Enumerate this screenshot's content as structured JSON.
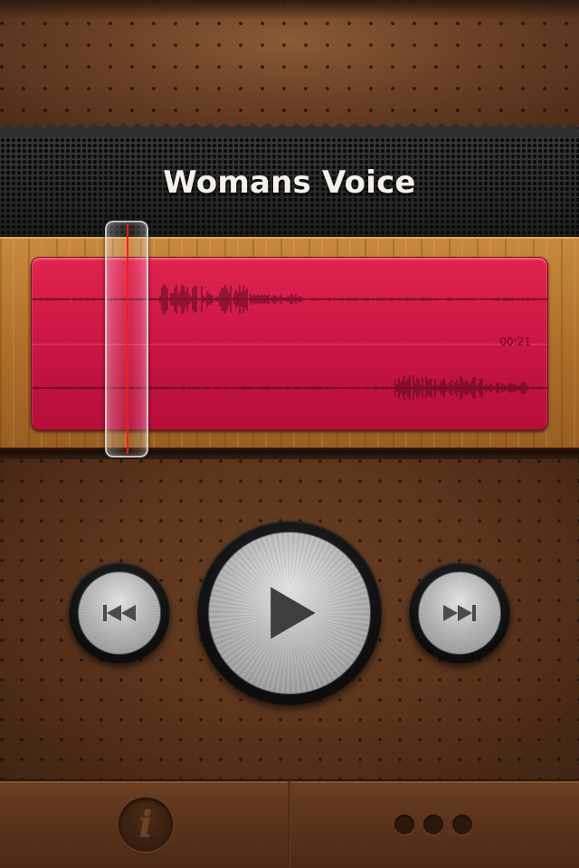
{
  "header": {
    "title": "Womans Voice"
  },
  "waveform": {
    "duration_label": "00:21",
    "playhead_fraction": 0.19
  },
  "controls": {
    "rewind": {
      "icon": "rewind-icon"
    },
    "play": {
      "icon": "play-icon"
    },
    "forward": {
      "icon": "fast-forward-icon"
    }
  },
  "toolbar": {
    "info": {
      "icon": "info-icon",
      "glyph": "i"
    },
    "more": {
      "icon": "more-dots-icon"
    }
  },
  "colors": {
    "waveform_fill": "#d11a47",
    "playhead": "#ff1a1a",
    "title_text": "#f4f1ea"
  }
}
